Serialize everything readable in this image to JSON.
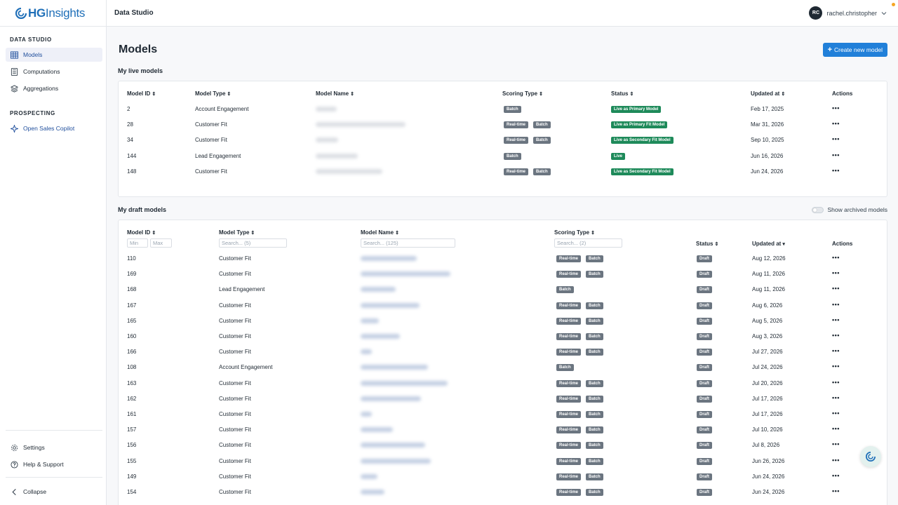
{
  "brand": {
    "name_bold": "HG",
    "name_rest": "Insights",
    "color": "#1f6fb8"
  },
  "app": {
    "title": "Data Studio"
  },
  "user": {
    "initials": "RC",
    "name": "rachel.christopher"
  },
  "sidebar": {
    "section_data_studio": "DATA STUDIO",
    "items": [
      {
        "label": "Models",
        "icon": "table-grid-icon",
        "active": true
      },
      {
        "label": "Computations",
        "icon": "calculator-icon"
      },
      {
        "label": "Aggregations",
        "icon": "layers-icon"
      }
    ],
    "section_prospecting": "PROSPECTING",
    "prospecting_items": [
      {
        "label": "Open Sales Copilot",
        "icon": "copilot-icon"
      }
    ],
    "bottom_items": [
      {
        "label": "Settings",
        "icon": "gear-icon"
      },
      {
        "label": "Help & Support",
        "icon": "help-circle-icon"
      }
    ],
    "collapse_label": "Collapse"
  },
  "page": {
    "title": "Models",
    "create_button": "Create new model",
    "create_button_icon": "+",
    "accent_color": "#2180d9"
  },
  "live_models": {
    "title": "My live models",
    "headers": [
      "Model ID",
      "Model Type",
      "Model Name",
      "Scoring Type",
      "Status",
      "Updated at",
      "Actions"
    ],
    "rows": [
      {
        "id": "2",
        "type": "Account Engagement",
        "scoring": [
          "Batch"
        ],
        "status": "Live as Primary Model",
        "updated": "Feb 17, 2025"
      },
      {
        "id": "28",
        "type": "Customer Fit",
        "scoring": [
          "Real-time",
          "Batch"
        ],
        "status": "Live as Primary Fit Model",
        "updated": "Mar 31, 2026"
      },
      {
        "id": "34",
        "type": "Customer Fit",
        "scoring": [
          "Real-time",
          "Batch"
        ],
        "status": "Live as Secondary Fit Model",
        "updated": "Sep 10, 2025"
      },
      {
        "id": "144",
        "type": "Lead Engagement",
        "scoring": [
          "Batch"
        ],
        "status": "Live",
        "updated": "Jun 16, 2026"
      },
      {
        "id": "148",
        "type": "Customer Fit",
        "scoring": [
          "Real-time",
          "Batch"
        ],
        "status": "Live as Secondary Fit Model",
        "updated": "Jun 24, 2026"
      }
    ]
  },
  "draft_models": {
    "title": "My draft models",
    "show_archived_label": "Show archived models",
    "headers": [
      "Model ID",
      "Model Type",
      "Model Name",
      "Scoring Type",
      "Status",
      "Updated at",
      "Actions"
    ],
    "filters": {
      "id_min_placeholder": "Min",
      "id_max_placeholder": "Max",
      "type_placeholder": "Search... (5)",
      "name_placeholder": "Search... (125)",
      "scoring_placeholder": "Search... (2)"
    },
    "status_label": "Draft",
    "rows": [
      {
        "id": "110",
        "type": "Customer Fit",
        "scoring": [
          "Real-time",
          "Batch"
        ],
        "updated": "Aug 12, 2026"
      },
      {
        "id": "169",
        "type": "Customer Fit",
        "scoring": [
          "Real-time",
          "Batch"
        ],
        "updated": "Aug 11, 2026"
      },
      {
        "id": "168",
        "type": "Lead Engagement",
        "scoring": [
          "Batch"
        ],
        "updated": "Aug 11, 2026"
      },
      {
        "id": "167",
        "type": "Customer Fit",
        "scoring": [
          "Real-time",
          "Batch"
        ],
        "updated": "Aug 6, 2026"
      },
      {
        "id": "165",
        "type": "Customer Fit",
        "scoring": [
          "Real-time",
          "Batch"
        ],
        "updated": "Aug 5, 2026"
      },
      {
        "id": "160",
        "type": "Customer Fit",
        "scoring": [
          "Real-time",
          "Batch"
        ],
        "updated": "Aug 3, 2026"
      },
      {
        "id": "166",
        "type": "Customer Fit",
        "scoring": [
          "Real-time",
          "Batch"
        ],
        "updated": "Jul 27, 2026"
      },
      {
        "id": "108",
        "type": "Account Engagement",
        "scoring": [
          "Batch"
        ],
        "updated": "Jul 24, 2026"
      },
      {
        "id": "163",
        "type": "Customer Fit",
        "scoring": [
          "Real-time",
          "Batch"
        ],
        "updated": "Jul 20, 2026"
      },
      {
        "id": "162",
        "type": "Customer Fit",
        "scoring": [
          "Real-time",
          "Batch"
        ],
        "updated": "Jul 17, 2026"
      },
      {
        "id": "161",
        "type": "Customer Fit",
        "scoring": [
          "Real-time",
          "Batch"
        ],
        "updated": "Jul 17, 2026"
      },
      {
        "id": "157",
        "type": "Customer Fit",
        "scoring": [
          "Real-time",
          "Batch"
        ],
        "updated": "Jul 10, 2026"
      },
      {
        "id": "156",
        "type": "Customer Fit",
        "scoring": [
          "Real-time",
          "Batch"
        ],
        "updated": "Jul 8, 2026"
      },
      {
        "id": "155",
        "type": "Customer Fit",
        "scoring": [
          "Real-time",
          "Batch"
        ],
        "updated": "Jun 26, 2026"
      },
      {
        "id": "149",
        "type": "Customer Fit",
        "scoring": [
          "Real-time",
          "Batch"
        ],
        "updated": "Jun 24, 2026"
      },
      {
        "id": "154",
        "type": "Customer Fit",
        "scoring": [
          "Real-time",
          "Batch"
        ],
        "updated": "Jun 24, 2026"
      }
    ]
  },
  "colors": {
    "live_badge": "#1e8a5a",
    "scoring_badge": "#6b7580",
    "draft_badge": "#6b7580"
  }
}
